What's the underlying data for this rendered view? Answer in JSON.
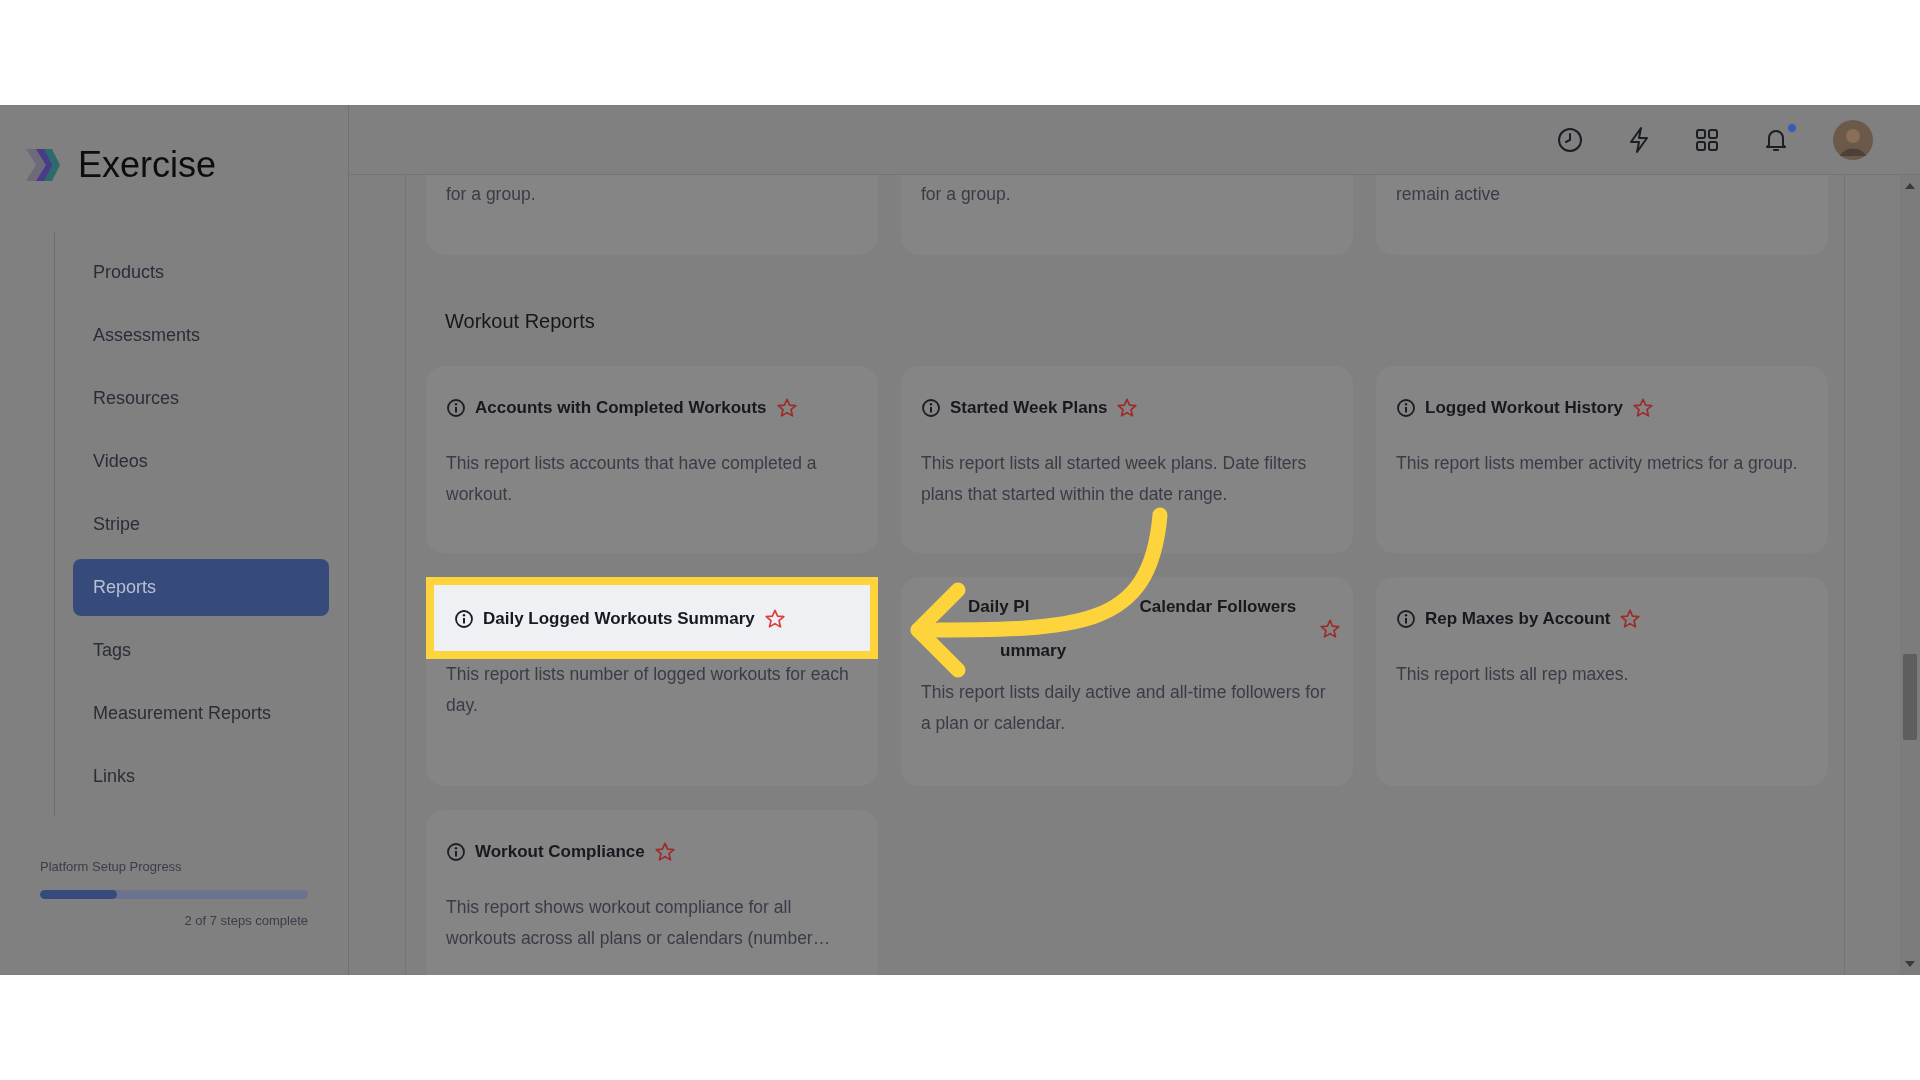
{
  "app": {
    "name": "Exercise"
  },
  "sidebar": {
    "items": [
      {
        "label": "Products",
        "selected": false
      },
      {
        "label": "Assessments",
        "selected": false
      },
      {
        "label": "Resources",
        "selected": false
      },
      {
        "label": "Videos",
        "selected": false
      },
      {
        "label": "Stripe",
        "selected": false
      },
      {
        "label": "Reports",
        "selected": true
      },
      {
        "label": "Tags",
        "selected": false
      },
      {
        "label": "Measurement Reports",
        "selected": false
      },
      {
        "label": "Links",
        "selected": false
      }
    ]
  },
  "setup_progress": {
    "label": "Platform Setup Progress",
    "level": 0.286,
    "caption": "2 of 7 steps complete"
  },
  "header": {
    "notifications_unread": true
  },
  "partial_cards": [
    {
      "text": "for a group."
    },
    {
      "text": "for a group."
    },
    {
      "text": "remain active"
    }
  ],
  "section": {
    "title": "Workout Reports",
    "cards": [
      {
        "title": "Accounts with Completed Workouts",
        "description": "This report lists accounts that have completed a workout.",
        "favorite": false,
        "highlighted": false
      },
      {
        "title": "Started Week Plans",
        "description": "This report lists all started week plans. Date filters plans that started within the date range.",
        "favorite": false,
        "highlighted": false
      },
      {
        "title": "Logged Workout History",
        "description": "This report lists member activity metrics for a group.",
        "favorite": false,
        "highlighted": false
      },
      {
        "title": "Daily Logged Workouts Summary",
        "description": "This report lists number of logged workouts for each day.",
        "favorite": false,
        "highlighted": true
      },
      {
        "title_fragments": [
          "Daily Pl",
          "Calendar Followers",
          "ummary"
        ],
        "description": "This report lists daily active and all-time followers for a plan or calendar.",
        "favorite": false,
        "highlighted": false
      },
      {
        "title": "Rep Maxes by Account",
        "description": "This report lists all rep maxes.",
        "favorite": false,
        "highlighted": false
      },
      {
        "title": "Workout Compliance",
        "description": "This report shows workout compliance for all workouts across all plans or calendars (number…",
        "favorite": false,
        "highlighted": false
      }
    ]
  }
}
